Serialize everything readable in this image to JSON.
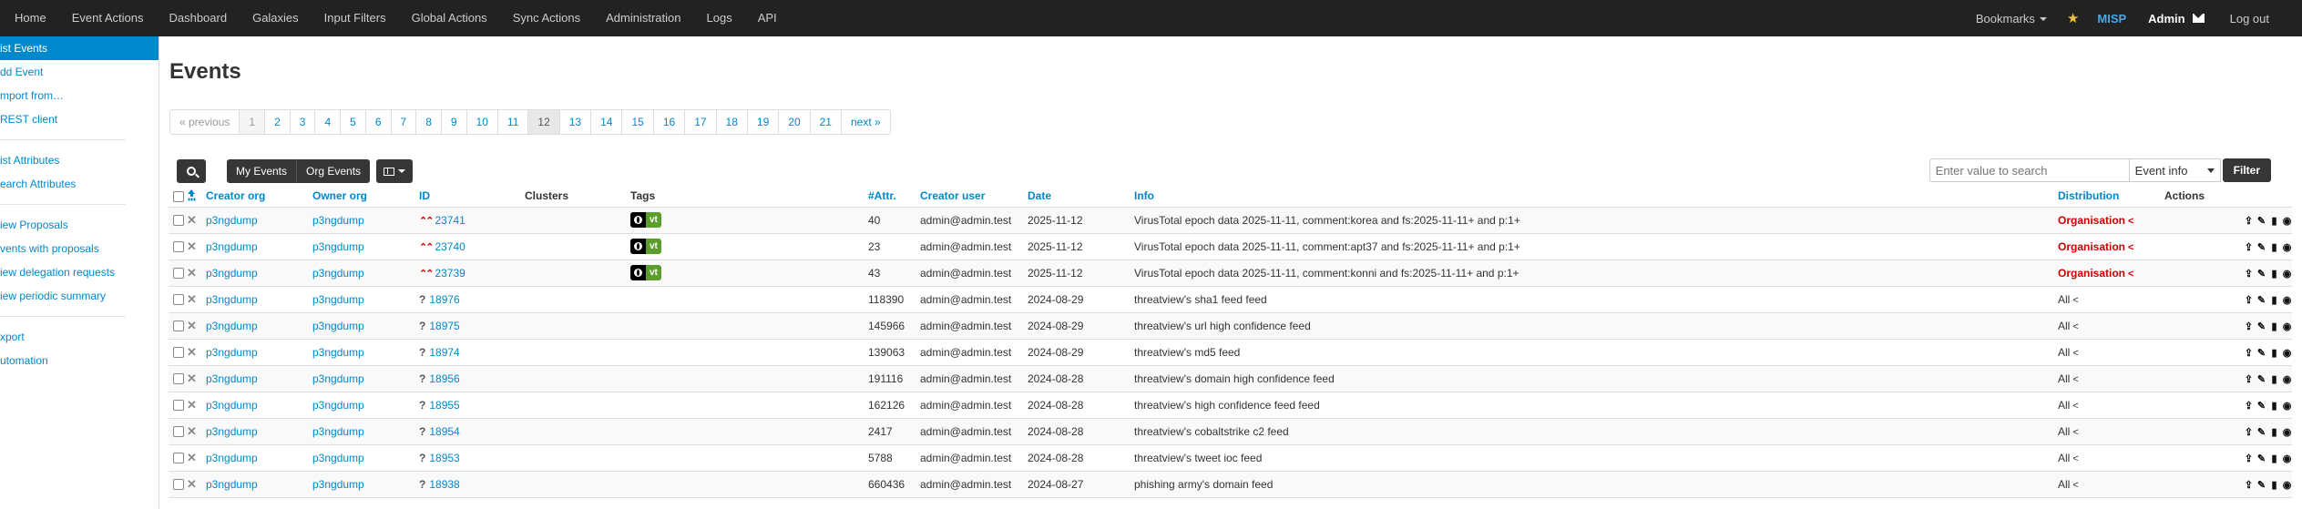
{
  "nav": {
    "items": [
      "Home",
      "Event Actions",
      "Dashboard",
      "Galaxies",
      "Input Filters",
      "Global Actions",
      "Sync Actions",
      "Administration",
      "Logs",
      "API"
    ],
    "bookmarks": "Bookmarks",
    "brand": "MISP",
    "user": "Admin",
    "logout": "Log out"
  },
  "sidebar": {
    "group1": [
      "ist Events",
      "dd Event",
      "mport from…",
      "REST client"
    ],
    "group2": [
      "ist Attributes",
      "earch Attributes"
    ],
    "group3": [
      "iew Proposals",
      "vents with proposals",
      "iew delegation requests",
      "iew periodic summary"
    ],
    "group4": [
      "xport",
      "utomation"
    ]
  },
  "page": {
    "title": "Events"
  },
  "pagination": [
    "« previous",
    "1",
    "2",
    "3",
    "4",
    "5",
    "6",
    "7",
    "8",
    "9",
    "10",
    "11",
    "12",
    "13",
    "14",
    "15",
    "16",
    "17",
    "18",
    "19",
    "20",
    "21",
    "next »"
  ],
  "toolbar": {
    "my_events": "My Events",
    "org_events": "Org Events",
    "search_placeholder": "Enter value to search",
    "search_scope": "Event info",
    "filter": "Filter"
  },
  "table": {
    "headers": {
      "creator_org": "Creator org",
      "owner_org": "Owner org",
      "id": "ID",
      "clusters": "Clusters",
      "tags": "Tags",
      "attr": "#Attr.",
      "creator_user": "Creator user",
      "date": "Date",
      "info": "Info",
      "distribution": "Distribution",
      "actions": "Actions"
    },
    "rows": [
      {
        "creator_org": "p3ngdump",
        "owner_org": "p3ngdump",
        "id": "23741",
        "threat": "high",
        "tag": "vt",
        "attr": "40",
        "user": "admin@admin.test",
        "date": "2025-11-12",
        "info": "VirusTotal epoch data 2025-11-11, comment:korea and fs:2025-11-11+ and p:1+",
        "distribution": "Organisation"
      },
      {
        "creator_org": "p3ngdump",
        "owner_org": "p3ngdump",
        "id": "23740",
        "threat": "high",
        "tag": "vt",
        "attr": "23",
        "user": "admin@admin.test",
        "date": "2025-11-12",
        "info": "VirusTotal epoch data 2025-11-11, comment:apt37 and fs:2025-11-11+ and p:1+",
        "distribution": "Organisation"
      },
      {
        "creator_org": "p3ngdump",
        "owner_org": "p3ngdump",
        "id": "23739",
        "threat": "high",
        "tag": "vt",
        "attr": "43",
        "user": "admin@admin.test",
        "date": "2025-11-12",
        "info": "VirusTotal epoch data 2025-11-11, comment:konni and fs:2025-11-11+ and p:1+",
        "distribution": "Organisation"
      },
      {
        "creator_org": "p3ngdump",
        "owner_org": "p3ngdump",
        "id": "18976",
        "threat": "undefined",
        "tag": "",
        "attr": "118390",
        "user": "admin@admin.test",
        "date": "2024-08-29",
        "info": "threatview's sha1 feed feed",
        "distribution": "All"
      },
      {
        "creator_org": "p3ngdump",
        "owner_org": "p3ngdump",
        "id": "18975",
        "threat": "undefined",
        "tag": "",
        "attr": "145966",
        "user": "admin@admin.test",
        "date": "2024-08-29",
        "info": "threatview's url high confidence feed",
        "distribution": "All"
      },
      {
        "creator_org": "p3ngdump",
        "owner_org": "p3ngdump",
        "id": "18974",
        "threat": "undefined",
        "tag": "",
        "attr": "139063",
        "user": "admin@admin.test",
        "date": "2024-08-29",
        "info": "threatview's md5 feed",
        "distribution": "All"
      },
      {
        "creator_org": "p3ngdump",
        "owner_org": "p3ngdump",
        "id": "18956",
        "threat": "undefined",
        "tag": "",
        "attr": "191116",
        "user": "admin@admin.test",
        "date": "2024-08-28",
        "info": "threatview's domain high confidence feed",
        "distribution": "All"
      },
      {
        "creator_org": "p3ngdump",
        "owner_org": "p3ngdump",
        "id": "18955",
        "threat": "undefined",
        "tag": "",
        "attr": "162126",
        "user": "admin@admin.test",
        "date": "2024-08-28",
        "info": "threatview's high confidence feed feed",
        "distribution": "All"
      },
      {
        "creator_org": "p3ngdump",
        "owner_org": "p3ngdump",
        "id": "18954",
        "threat": "undefined",
        "tag": "",
        "attr": "2417",
        "user": "admin@admin.test",
        "date": "2024-08-28",
        "info": "threatview's cobaltstrike c2 feed",
        "distribution": "All"
      },
      {
        "creator_org": "p3ngdump",
        "owner_org": "p3ngdump",
        "id": "18953",
        "threat": "undefined",
        "tag": "",
        "attr": "5788",
        "user": "admin@admin.test",
        "date": "2024-08-28",
        "info": "threatview's tweet ioc feed",
        "distribution": "All"
      },
      {
        "creator_org": "p3ngdump",
        "owner_org": "p3ngdump",
        "id": "18938",
        "threat": "undefined",
        "tag": "",
        "attr": "660436",
        "user": "admin@admin.test",
        "date": "2024-08-27",
        "info": "phishing army's domain feed",
        "distribution": "All"
      }
    ]
  },
  "colors": {
    "link": "#0088cc",
    "navbar": "#222222",
    "org_distribution": "#cc0000",
    "tag_vt": "#5a9e2c"
  }
}
